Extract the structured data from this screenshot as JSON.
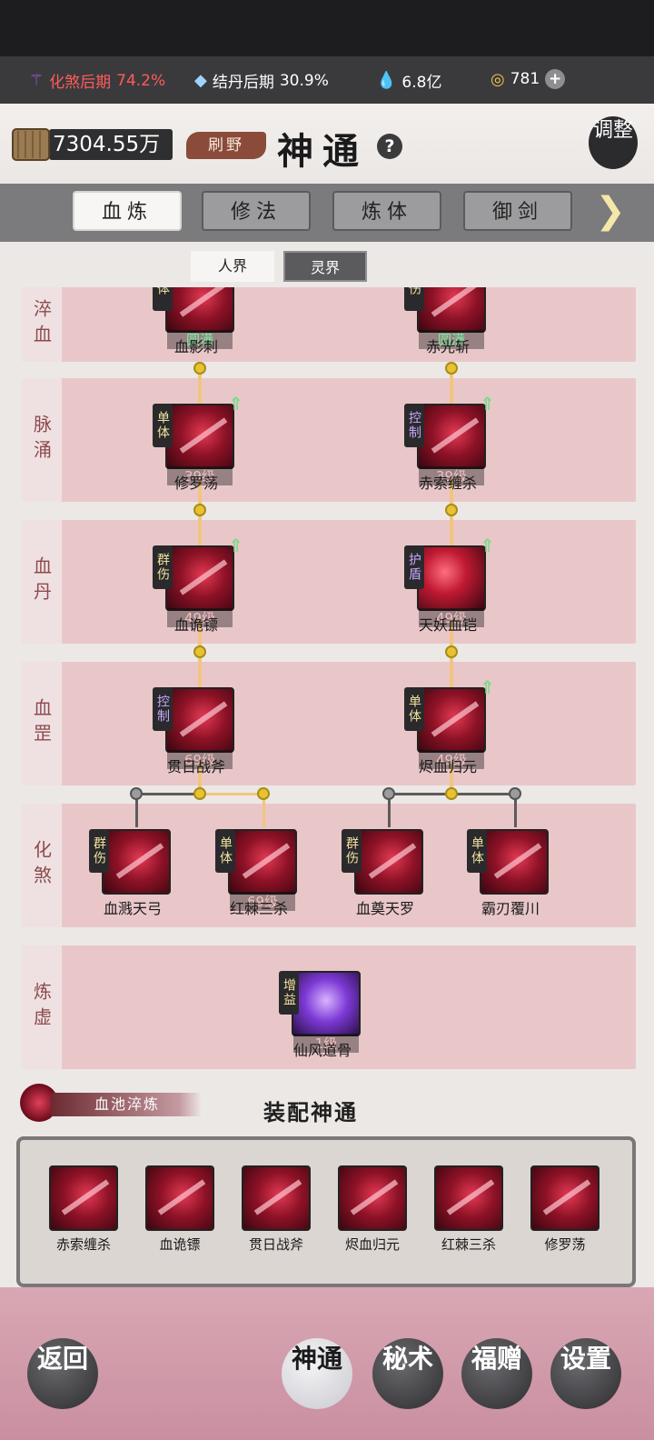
{
  "status": {
    "realm1": {
      "label": "化煞后期",
      "pct": "74.2%"
    },
    "realm2": {
      "label": "结丹后期",
      "pct": "30.9%"
    },
    "stones": "6.8亿",
    "gold": "781"
  },
  "header": {
    "coins": "7304.55万",
    "grind": "刷野",
    "title": "神通",
    "help": "?",
    "adjust": "调整"
  },
  "tabs": [
    {
      "label": "血炼",
      "active": true
    },
    {
      "label": "修法"
    },
    {
      "label": "炼体"
    },
    {
      "label": "御剑"
    }
  ],
  "realm_switch": {
    "human": "人界",
    "spirit": "灵界"
  },
  "rows": [
    {
      "label": "淬血",
      "skills": [
        {
          "name": "血影刺",
          "tag": "体",
          "level": "圆满"
        },
        {
          "name": "赤光斩",
          "tag": "伤",
          "level": "圆满"
        }
      ]
    },
    {
      "label": "脉涌",
      "skills": [
        {
          "name": "修罗荡",
          "tag": "单体",
          "level": "39级"
        },
        {
          "name": "赤索缠杀",
          "tag": "控制",
          "level": "39级"
        }
      ]
    },
    {
      "label": "血丹",
      "skills": [
        {
          "name": "血诡镖",
          "tag": "群伤",
          "level": "49级"
        },
        {
          "name": "天妖血铠",
          "tag": "护盾",
          "level": "49级"
        }
      ]
    },
    {
      "label": "血罡",
      "skills": [
        {
          "name": "贯日战斧",
          "tag": "控制",
          "level": "69级"
        },
        {
          "name": "烬血归元",
          "tag": "单体",
          "level": "49级"
        }
      ]
    },
    {
      "label": "化煞",
      "skills": [
        {
          "name": "血溅天弓",
          "tag": "群伤",
          "level": ""
        },
        {
          "name": "红棘三杀",
          "tag": "单体",
          "level": "69级"
        },
        {
          "name": "血奠天罗",
          "tag": "群伤",
          "level": ""
        },
        {
          "name": "霸刃覆川",
          "tag": "单体",
          "level": ""
        }
      ]
    },
    {
      "label": "炼虚",
      "skills": [
        {
          "name": "仙风道骨",
          "tag": "增益",
          "level": "1级"
        }
      ]
    }
  ],
  "equip": {
    "blood_pool": "血池淬炼",
    "title": "装配神通",
    "items": [
      "赤索缠杀",
      "血诡镖",
      "贯日战斧",
      "烬血归元",
      "红棘三杀",
      "修罗荡"
    ]
  },
  "nav": {
    "back": "返回",
    "shentong": "神通",
    "mishu": "秘术",
    "fuzeng": "福赠",
    "settings": "设置"
  },
  "colors": {
    "accent": "#e8c230",
    "row": "#e8babe",
    "tab_active": "#f7f6f4"
  }
}
